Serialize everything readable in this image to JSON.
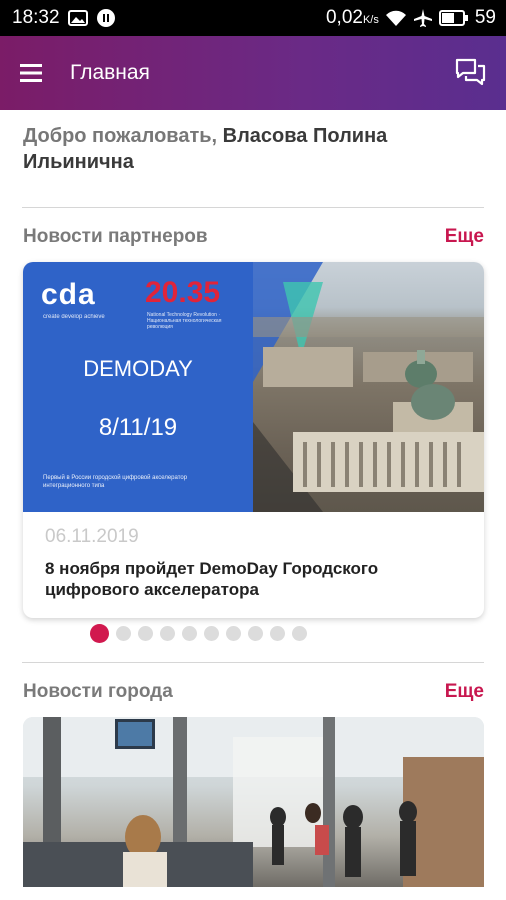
{
  "status_bar": {
    "time": "18:32",
    "data_rate": "0,02",
    "data_unit": "K/s",
    "battery": "59",
    "icons": [
      "image-icon",
      "pause-icon",
      "wifi-icon",
      "airplane-icon",
      "battery-icon"
    ]
  },
  "app_bar": {
    "title": "Главная",
    "menu_icon": "hamburger-menu-icon",
    "chat_icon": "chat-bubbles-icon",
    "gradient": [
      "#7b1c67",
      "#5a2e8f"
    ]
  },
  "welcome": {
    "greeting": "Добро пожаловать,",
    "name": "Власова Полина Ильинична"
  },
  "partner_news": {
    "title": "Новости партнеров",
    "more": "Еще",
    "card": {
      "image_text": {
        "logo": "cda",
        "logo_sub": "create develop achieve",
        "number": "20.35",
        "number_sub": "National Technology Revolution · Национальная технологическая революция",
        "headline": "DEMODAY",
        "date": "8/11/19",
        "footer": "Первый в России городской цифровой акселератор интеграционного типа"
      },
      "date": "06.11.2019",
      "title": "8 ноября пройдет DemoDay Городского цифрового акселератора"
    },
    "pager": {
      "count": 10,
      "active": 0
    }
  },
  "city_news": {
    "title": "Новости города",
    "more": "Еще"
  },
  "colors": {
    "accent": "#c8174f",
    "pager_active": "#d1184e",
    "card_blue": "#2f63c8"
  }
}
